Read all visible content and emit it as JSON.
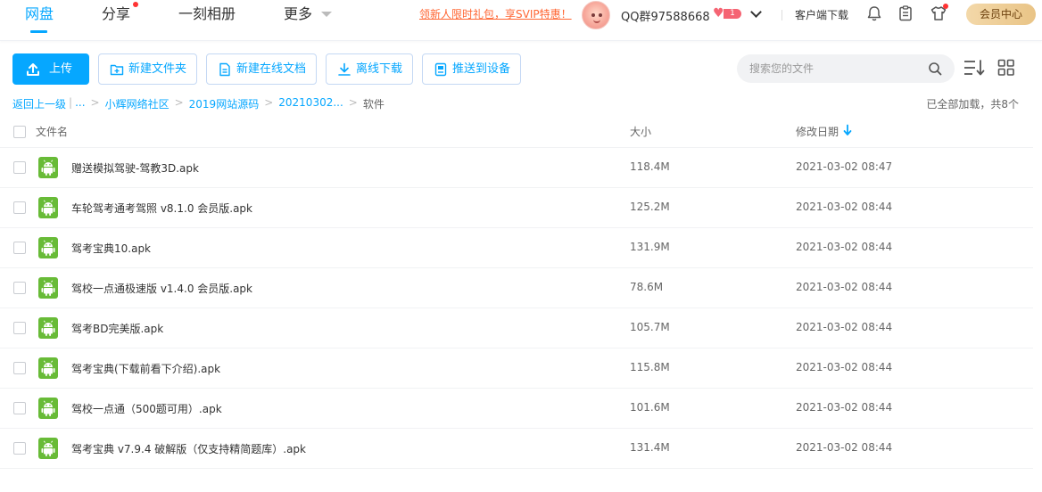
{
  "nav": {
    "items": [
      "网盘",
      "分享",
      "一刻相册",
      "更多"
    ],
    "promo": "领新人限时礼包，享SVIP特惠！",
    "username": "QQ群97588668",
    "vip_level": "1",
    "client_download": "客户端下载",
    "vip_center": "会员中心"
  },
  "toolbar": {
    "upload": "上传",
    "new_folder": "新建文件夹",
    "new_doc": "新建在线文档",
    "offline_download": "离线下载",
    "push_device": "推送到设备",
    "search_placeholder": "搜索您的文件"
  },
  "breadcrumb": {
    "back": "返回上一级",
    "ellipsis": "...",
    "path": [
      "小辉网络社区",
      "2019网站源码",
      "20210302..."
    ],
    "current": "软件"
  },
  "status": {
    "loaded": "已全部加载，共8个"
  },
  "table": {
    "headers": {
      "name": "文件名",
      "size": "大小",
      "date": "修改日期"
    },
    "rows": [
      {
        "name": "赠送模拟驾驶-驾教3D.apk",
        "size": "118.4M",
        "date": "2021-03-02 08:47"
      },
      {
        "name": "车轮驾考通考驾照 v8.1.0 会员版.apk",
        "size": "125.2M",
        "date": "2021-03-02 08:44"
      },
      {
        "name": "驾考宝典10.apk",
        "size": "131.9M",
        "date": "2021-03-02 08:44"
      },
      {
        "name": "驾校一点通极速版 v1.4.0 会员版.apk",
        "size": "78.6M",
        "date": "2021-03-02 08:44"
      },
      {
        "name": "驾考BD完美版.apk",
        "size": "105.7M",
        "date": "2021-03-02 08:44"
      },
      {
        "name": "驾考宝典(下载前看下介绍).apk",
        "size": "115.8M",
        "date": "2021-03-02 08:44"
      },
      {
        "name": "驾校一点通（500题可用）.apk",
        "size": "101.6M",
        "date": "2021-03-02 08:44"
      },
      {
        "name": "驾考宝典 v7.9.4 破解版（仅支持精简题库）.apk",
        "size": "131.4M",
        "date": "2021-03-02 08:44"
      }
    ]
  },
  "colors": {
    "accent": "#06a7ff",
    "apk_icon": "#68bb37",
    "promo": "#ff6633",
    "vip_gold": "#e9c486"
  },
  "icons": [
    "upload-icon",
    "new-folder-icon",
    "document-icon",
    "download-icon",
    "device-icon",
    "search-icon",
    "sort-list-icon",
    "grid-view-icon",
    "bell-icon",
    "clipboard-icon",
    "tshirt-icon",
    "android-apk-icon"
  ]
}
